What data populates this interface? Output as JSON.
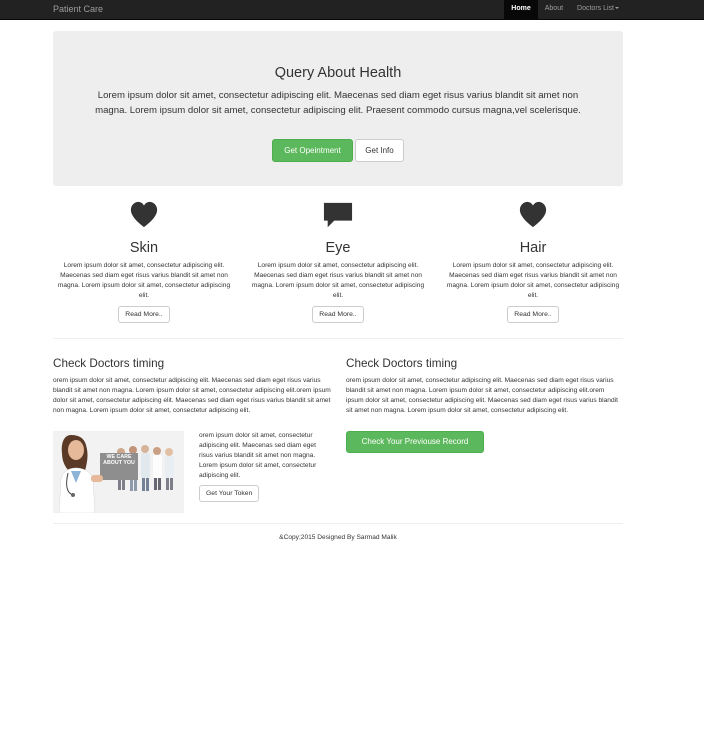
{
  "navbar": {
    "brand": "Patient Care",
    "items": [
      {
        "label": "Home"
      },
      {
        "label": "About"
      },
      {
        "label": "Doctors List"
      }
    ]
  },
  "jumbotron": {
    "title": "Query About Health",
    "text": "Lorem ipsum dolor sit amet, consectetur adipiscing elit. Maecenas sed diam eget risus varius blandit sit amet non magna. Lorem ipsum dolor sit amet, consectetur adipiscing elit. Praesent commodo cursus magna,vel scelerisque.",
    "primary_button": "Get Opeintment",
    "secondary_button": "Get Info"
  },
  "features": [
    {
      "icon": "heart-icon",
      "title": "Skin",
      "text": "Lorem ipsum dolor sit amet, consectetur adipiscing elit. Maecenas sed diam eget risus varius blandit sit amet non magna. Lorem ipsum dolor sit amet, consectetur adipiscing elit.",
      "button": "Read More.."
    },
    {
      "icon": "comment-icon",
      "title": "Eye",
      "text": "Lorem ipsum dolor sit amet, consectetur adipiscing elit. Maecenas sed diam eget risus varius blandit sit amet non magna. Lorem ipsum dolor sit amet, consectetur adipiscing elit.",
      "button": "Read More.."
    },
    {
      "icon": "heart-icon",
      "title": "Hair",
      "text": "Lorem ipsum dolor sit amet, consectetur adipiscing elit. Maecenas sed diam eget risus varius blandit sit amet non magna. Lorem ipsum dolor sit amet, consectetur adipiscing elit.",
      "button": "Read More.."
    }
  ],
  "left_section": {
    "title": "Check Doctors timing",
    "text": "orem ipsum dolor sit amet, consectetur adipiscing elit. Maecenas sed diam eget risus varius blandit sit amet non magna. Lorem ipsum dolor sit amet, consectetur adipiscing elit.orem ipsum dolor sit amet, consectetur adipiscing elit. Maecenas sed diam eget risus varius blandit sit amet non magna. Lorem ipsum dolor sit amet, consectetur adipiscing elit.",
    "image_sign": "WE CARE ABOUT YOU",
    "side_text": "orem ipsum dolor sit amet, consectetur adipiscing elit. Maecenas sed diam eget risus varius blandit sit amet non magna. Lorem ipsum dolor sit amet, consectetur adipiscing elit.",
    "button": "Get Your Token"
  },
  "right_section": {
    "title": "Check Doctors timing",
    "text": "orem ipsum dolor sit amet, consectetur adipiscing elit. Maecenas sed diam eget risus varius blandit sit amet non magna. Lorem ipsum dolor sit amet, consectetur adipiscing elit.orem ipsum dolor sit amet, consectetur adipiscing elit. Maecenas sed diam eget risus varius blandit sit amet non magna. Lorem ipsum dolor sit amet, consectetur adipiscing elit.",
    "button": "Check Your Previouse Record"
  },
  "footer": {
    "text": "&Copy;2015 Designed By Sarmad Malik"
  },
  "colors": {
    "navbar_bg": "#222222",
    "success": "#5cb85c",
    "jumbotron_bg": "#eeeeee"
  }
}
